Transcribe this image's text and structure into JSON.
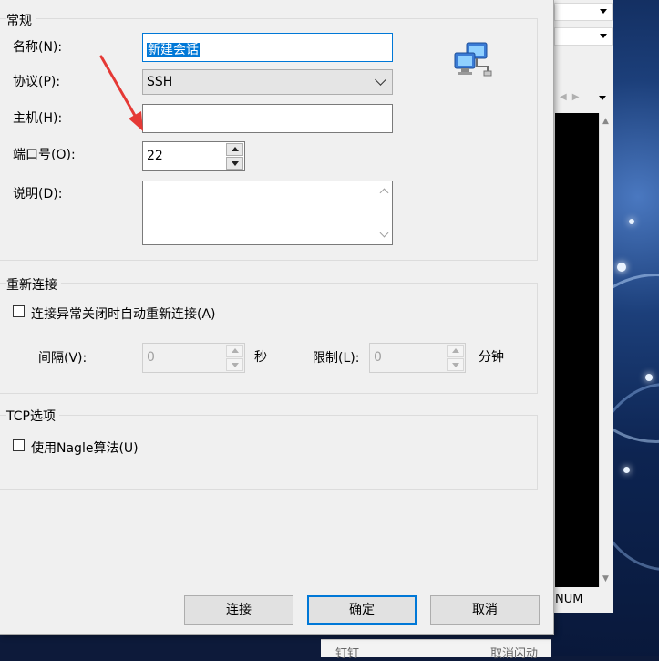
{
  "dialog": {
    "general": {
      "title": "常规",
      "name_label": "名称(N):",
      "name_value": "新建会话",
      "protocol_label": "协议(P):",
      "protocol_value": "SSH",
      "host_label": "主机(H):",
      "host_value": "",
      "port_label": "端口号(O):",
      "port_value": "22",
      "desc_label": "说明(D):",
      "desc_value": "",
      "icon": "network-computers-icon"
    },
    "reconnect": {
      "title": "重新连接",
      "auto_label": "连接异常关闭时自动重新连接(A)",
      "auto_checked": false,
      "interval_label": "间隔(V):",
      "interval_value": "0",
      "interval_unit": "秒",
      "limit_label": "限制(L):",
      "limit_value": "0",
      "limit_unit": "分钟"
    },
    "tcp": {
      "title": "TCP选项",
      "nagle_label": "使用Nagle算法(U)",
      "nagle_checked": false
    },
    "buttons": {
      "connect": "连接",
      "ok": "确定",
      "cancel": "取消"
    }
  },
  "background_app": {
    "status_text": "NUM"
  },
  "taskbar_popup": {
    "left_text": "钉钉",
    "right_text": "取消闪动"
  },
  "colors": {
    "accent": "#0078d7",
    "annotation_arrow": "#e53935",
    "dialog_bg": "#f0f0f0"
  }
}
